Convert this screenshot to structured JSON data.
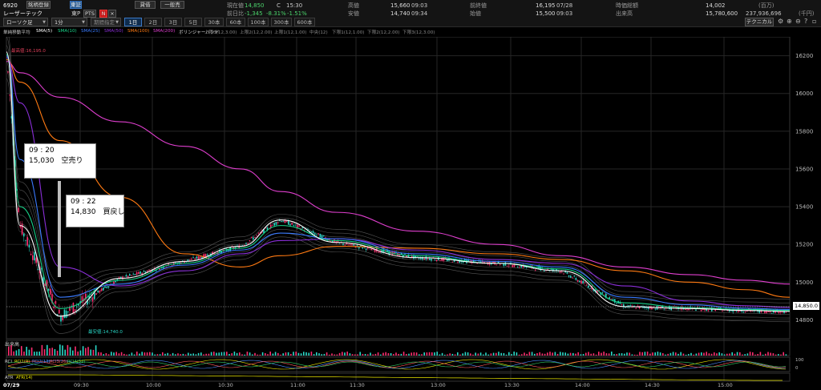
{
  "header": {
    "code": "6920",
    "name_button": "銘柄登録",
    "market_button": "東証",
    "exchange": "東P",
    "company": "レーザーテック",
    "credit_button": "貸借",
    "general_button": "一般売",
    "pts_button": "PTS",
    "n_badge": "N",
    "close_icon_label": "×"
  },
  "quote": {
    "current_label": "現在値",
    "current_value": "14,850",
    "current_flag": "C",
    "current_time": "15:30",
    "change_label": "前日比",
    "change_value": "-1,345",
    "change_pct": "-8.31%",
    "change_pct2": "-1.51%",
    "high_label": "高値",
    "high_value": "15,660",
    "high_time": "09:03",
    "low_label": "安値",
    "low_value": "14,740",
    "low_time": "09:34",
    "prev_label": "前終値",
    "prev_value": "16,195",
    "prev_date": "07/28",
    "open_label": "始値",
    "open_value": "15,500",
    "open_time": "09:03",
    "cap_label": "時価総額",
    "cap_value": "14,002",
    "cap_unit": "(百万)",
    "volume_label": "出来高",
    "volume_value": "15,780,600",
    "turnover_value": "237,936,696",
    "turnover_unit": "(千円)"
  },
  "toolbar": {
    "chart_type": "ローソク足",
    "interval": "1分",
    "period": "期間指定",
    "timeframes": [
      "1日",
      "2日",
      "3日",
      "5日",
      "30本",
      "60本",
      "100本",
      "300本",
      "600本"
    ],
    "selected_timeframe": "1日",
    "technical_button": "テクニカル"
  },
  "legend": {
    "title": "単純移動平均",
    "sma5": "SMA(5)",
    "sma10": "SMA(10)",
    "sma25": "SMA(25)",
    "sma50": "SMA(50)",
    "sma100": "SMA(100)",
    "sma200": "SMA(200)",
    "bb": "ボリンジャーバンド",
    "bb1": "上限3(12,3.00)",
    "bb2": "上限2(12,2.00)",
    "bb3": "上限1(12,1.00)",
    "bb4": "中央(12)",
    "bb5": "下限1(12,1.00)",
    "bb6": "下限2(12,2.00)",
    "bb7": "下限3(12,3.00)",
    "colors": {
      "sma5": "#ffffff",
      "sma10": "#19d48a",
      "sma25": "#3a7bff",
      "sma50": "#8b2fd9",
      "sma100": "#ff7a12",
      "sma200": "#e03fcf"
    }
  },
  "annotations": [
    {
      "time": "09 : 20",
      "text": "15,030　空売り"
    },
    {
      "time": "09 : 22",
      "text": "14,830　買戻し"
    }
  ],
  "markers": {
    "high": "最高値:16,195.0",
    "low": "最安値:14,740.0",
    "last_price": "14,850.0"
  },
  "chart_data": {
    "type": "line",
    "price_axis": [
      "16200",
      "16000",
      "15800",
      "15600",
      "15400",
      "15200",
      "15000",
      "14800"
    ],
    "time_axis": [
      "07/29",
      "09:30",
      "10:00",
      "10:30",
      "11:00",
      "11:30",
      "13:00",
      "13:30",
      "14:00",
      "14:30",
      "15:00"
    ],
    "ylim": [
      14700,
      16300
    ],
    "series": [
      {
        "name": "SMA(5)",
        "color": "#ffffff",
        "values": [
          16220,
          15300,
          14820,
          15020,
          15110,
          15190,
          15330,
          15210,
          15130,
          15100,
          15060,
          14870,
          14860,
          14850,
          14845
        ]
      },
      {
        "name": "SMA(10)",
        "color": "#19d48a",
        "values": [
          16210,
          15400,
          14860,
          15010,
          15100,
          15180,
          15300,
          15220,
          15140,
          15100,
          15070,
          14890,
          14865,
          14855,
          14850
        ]
      },
      {
        "name": "SMA(25)",
        "color": "#3a7bff",
        "values": [
          16200,
          15650,
          14920,
          14990,
          15090,
          15170,
          15260,
          15230,
          15150,
          15110,
          15080,
          14920,
          14880,
          14862,
          14855
        ]
      },
      {
        "name": "SMA(50)",
        "color": "#8b2fd9",
        "values": [
          16190,
          15950,
          15080,
          14980,
          15060,
          15150,
          15220,
          15230,
          15170,
          15120,
          15100,
          14980,
          14900,
          14875,
          14865
        ]
      },
      {
        "name": "SMA(100)",
        "color": "#ff7a12",
        "values": [
          16180,
          16060,
          15750,
          15450,
          15150,
          15080,
          15140,
          15190,
          15180,
          15150,
          15120,
          15060,
          15000,
          14960,
          14920
        ]
      },
      {
        "name": "SMA(200)",
        "color": "#e03fcf",
        "values": [
          16170,
          16110,
          15980,
          15850,
          15720,
          15600,
          15480,
          15370,
          15270,
          15200,
          15140,
          15080,
          15040,
          15010,
          14990
        ]
      }
    ],
    "volume_label": "出来高",
    "rci_label": "RCI",
    "rci_series": [
      "RCI1(9)",
      "RCI2(13)",
      "RCI3(26)",
      "RCI4(52)"
    ],
    "rci_ticks": [
      "100",
      "0"
    ],
    "atr_label": "ATR",
    "atr_series": "ATR(14)"
  }
}
